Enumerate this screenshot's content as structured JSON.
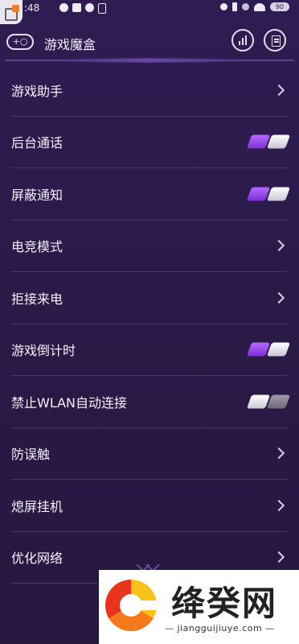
{
  "status_bar": {
    "time": ":48",
    "battery": "90"
  },
  "header": {
    "title": "游戏魔盒",
    "gamepad_icon_text": "+○"
  },
  "settings": [
    {
      "label": "游戏助手",
      "control": "chevron"
    },
    {
      "label": "后台通话",
      "control": "toggle",
      "state": "on"
    },
    {
      "label": "屏蔽通知",
      "control": "toggle",
      "state": "on"
    },
    {
      "label": "电竞模式",
      "control": "chevron"
    },
    {
      "label": "拒接来电",
      "control": "chevron"
    },
    {
      "label": "游戏倒计时",
      "control": "toggle",
      "state": "on"
    },
    {
      "label": "禁止WLAN自动连接",
      "control": "toggle",
      "state": "off"
    },
    {
      "label": "防误触",
      "control": "chevron"
    },
    {
      "label": "熄屏挂机",
      "control": "chevron"
    },
    {
      "label": "优化网络",
      "control": "chevron"
    }
  ],
  "watermark": {
    "title": "绛癸网",
    "url": "— jiangguijiuye.com —"
  },
  "colors": {
    "background": "#2b1c4a",
    "toggle_on": "#9b4dff",
    "divider": "#5a4a78"
  }
}
